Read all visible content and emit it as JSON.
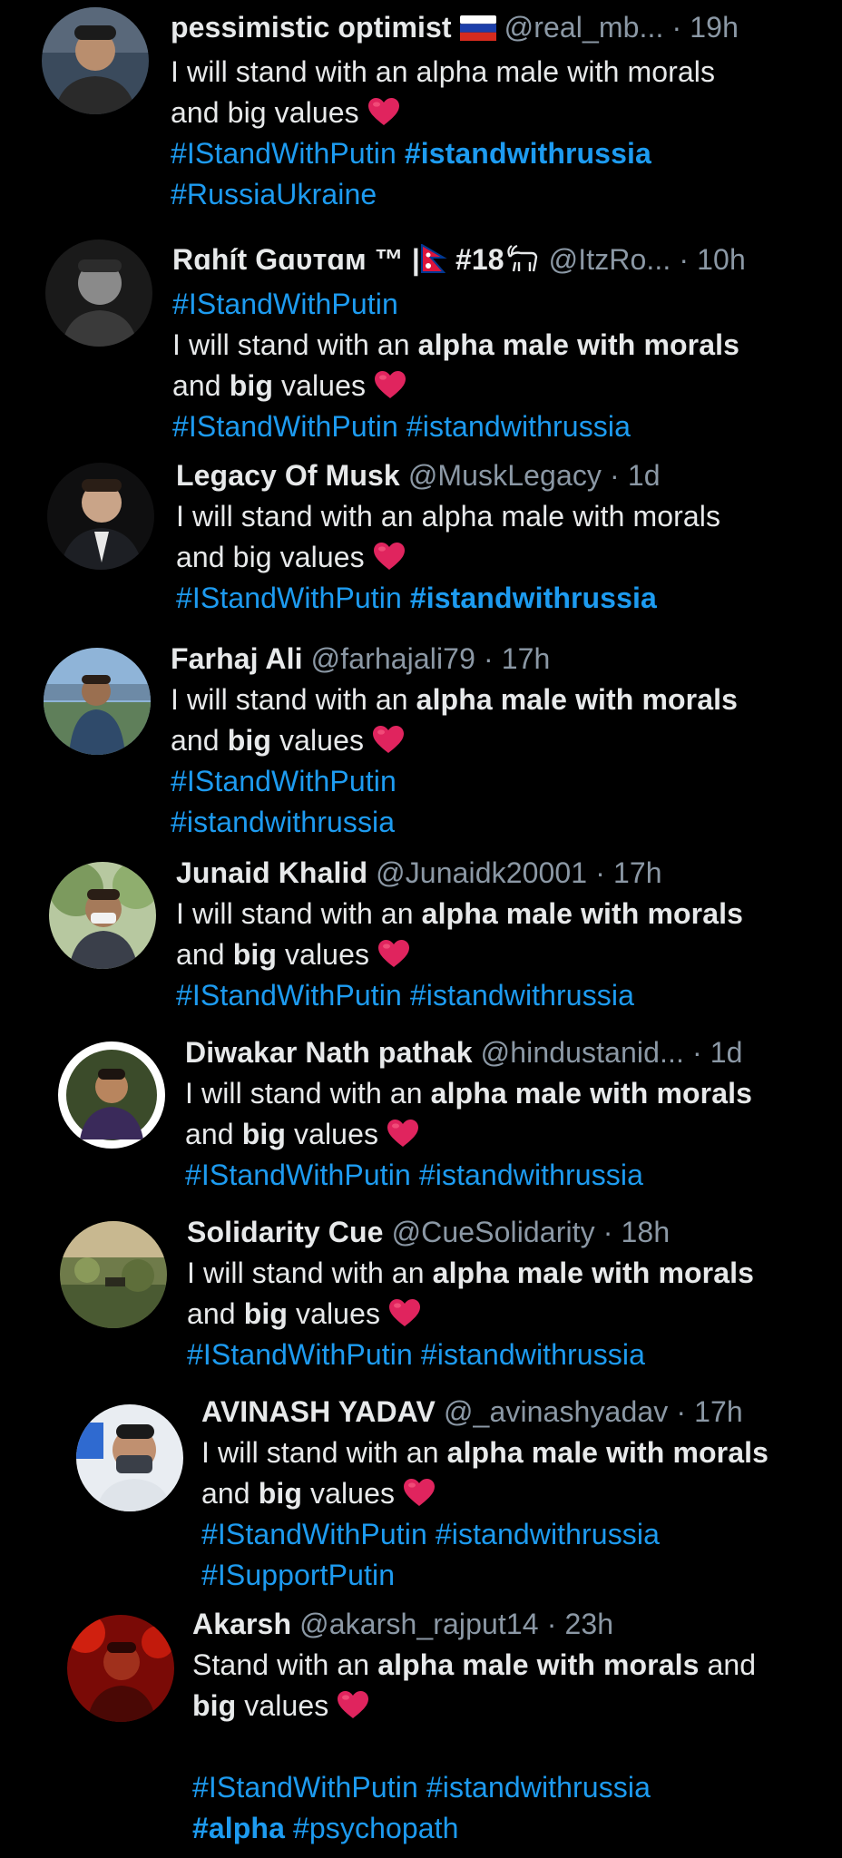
{
  "colors": {
    "background": "#000000",
    "text": "#e7e9ea",
    "secondary": "#8b98a5",
    "hashtag": "#1d9bf0",
    "heart": "#e0245e"
  },
  "icons": {
    "heart": "red-heart-emoji",
    "russia_flag": "russia-flag-emoji",
    "nepal_flag": "nepal-flag-emoji",
    "goat": "goat-emoji"
  },
  "common": {
    "sep": "·"
  },
  "tweets": [
    {
      "name": "pessimistic optimist",
      "handle": "@real_mb...",
      "time": "19h",
      "line1": "I will stand with an alpha male with morals",
      "line2": "and big values",
      "tag1": "#IStandWithPutin",
      "tag2": "#istandwithrussia",
      "tag3": "#RussiaUkraine"
    },
    {
      "name": "Rɑhít Gɑʋтɑм ™ |",
      "name_suffix": "#18",
      "handle": "@ItzRo...",
      "time": "10h",
      "tag1": "#IStandWithPutin",
      "t1": "I will stand with an ",
      "t2": "alpha male with morals",
      "t3": "and ",
      "t4": "big",
      "t5": " values",
      "tag2": "#IStandWithPutin",
      "tag3": "#istandwithrussia"
    },
    {
      "name": "Legacy Of Musk",
      "handle": "@MuskLegacy",
      "time": "1d",
      "line1": "I will stand with an alpha male with morals",
      "line2": "and big values",
      "tag1": "#IStandWithPutin",
      "tag2": "#istandwithrussia"
    },
    {
      "name": "Farhaj Ali",
      "handle": "@farhajali79",
      "time": "17h",
      "t1": "I will stand with an ",
      "t2": "alpha male with morals",
      "t3": "and ",
      "t4": "big",
      "t5": " values",
      "tag1": "#IStandWithPutin",
      "tag2": "#istandwithrussia"
    },
    {
      "name": "Junaid Khalid",
      "handle": "@Junaidk20001",
      "time": "17h",
      "t1": "I will stand with an ",
      "t2": "alpha male with morals",
      "t3": "and ",
      "t4": "big",
      "t5": " values",
      "tag1": "#IStandWithPutin",
      "tag2": "#istandwithrussia"
    },
    {
      "name": "Diwakar Nath pathak",
      "handle": "@hindustanid...",
      "time": "1d",
      "t1": "I will stand with an ",
      "t2": "alpha male with morals",
      "t3": "and ",
      "t4": "big",
      "t5": " values",
      "tag1": "#IStandWithPutin",
      "tag2": "#istandwithrussia"
    },
    {
      "name": "Solidarity Cue",
      "handle": "@CueSolidarity",
      "time": "18h",
      "t1": "I will stand with an ",
      "t2": "alpha male with morals",
      "t3": "and ",
      "t4": "big",
      "t5": " values",
      "tag1": "#IStandWithPutin",
      "tag2": "#istandwithrussia"
    },
    {
      "name": "AVINASH YADAV",
      "handle": "@_avinashyadav",
      "time": "17h",
      "t1": "I will stand with an ",
      "t2": "alpha male with morals",
      "t3": "and ",
      "t4": "big",
      "t5": " values",
      "tag1": "#IStandWithPutin",
      "tag2": "#istandwithrussia",
      "tag3": "#ISupportPutin"
    },
    {
      "name": "Akarsh",
      "handle": "@akarsh_rajput14",
      "time": "23h",
      "t1": "Stand with an ",
      "t2": "alpha male with morals",
      "t2b": " and",
      "t4": "big",
      "t5": " values",
      "tag1": "#IStandWithPutin",
      "tag2": "#istandwithrussia",
      "tag3": "#alpha",
      "tag4": "#psychopath"
    }
  ]
}
